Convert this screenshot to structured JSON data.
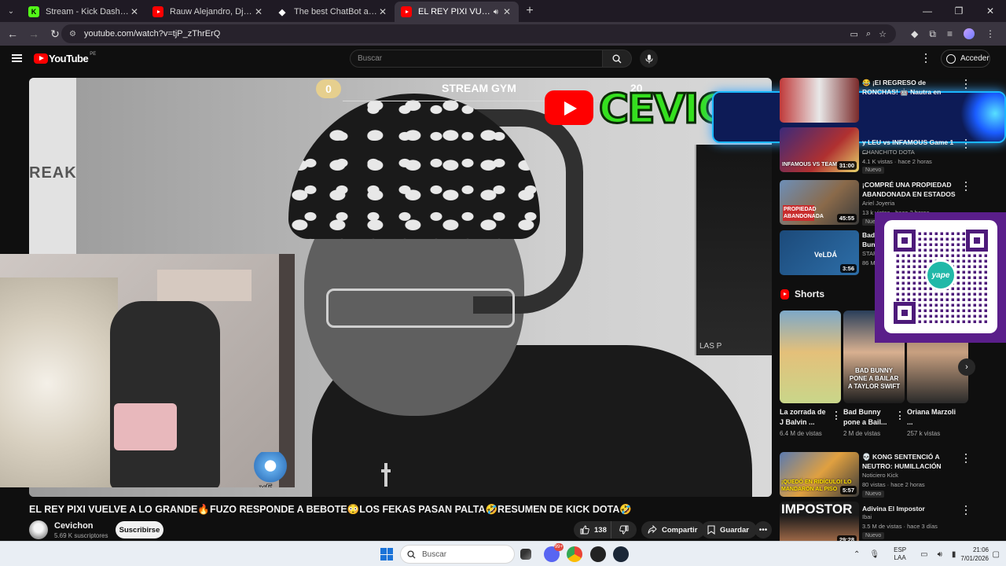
{
  "browser": {
    "tabs": [
      {
        "title": "Stream - Kick Dashboard",
        "favicon": "kick-icon",
        "color": "#53fc18",
        "active": false
      },
      {
        "title": "Rauw Alejandro, Dj Playero - Di",
        "favicon": "youtube-icon",
        "color": "#ff0000",
        "active": false
      },
      {
        "title": "The best ChatBot and Widgets",
        "favicon": "botrix-icon",
        "color": "#ffffff",
        "active": false
      },
      {
        "title": "EL REY PIXI VUELVE A LO G",
        "favicon": "youtube-icon",
        "color": "#ff0000",
        "active": true
      }
    ],
    "url": "youtube.com/watch?v=tjP_zThrErQ"
  },
  "youtube": {
    "logo_text": "YouTube",
    "region": "PE",
    "search_placeholder": "Buscar",
    "signin_label": "Acceder"
  },
  "player": {
    "score_left": "0",
    "score_title": "STREAM GYM",
    "score_right": "20",
    "brand_overlay": "CEVICHON",
    "streak_text": "REAK",
    "cam_badge": "x5",
    "side_text": "LAS P"
  },
  "video": {
    "title": "EL REY PIXI VUELVE A LO GRANDE🔥FUZO RESPONDE A BEBOTE😳LOS FEKAS PASAN PALTA🤣RESUMEN DE KICK DOTA🤣",
    "channel": "Cevichon",
    "subscribers": "5.69 K suscriptores",
    "subscribe_label": "Suscribirse",
    "likes": "138",
    "share_label": "Compartir",
    "save_label": "Guardar"
  },
  "sidebar": {
    "items": [
      {
        "title": "😂 ¡El REGRESO de RONCHAS! 🤖 Nautra en SLAPER BOXES",
        "channel": "",
        "meta": "",
        "duration": "",
        "new": ""
      },
      {
        "title": "y LEU vs INFAMOUS Game 1 ...",
        "channel": "CHANCHITO DOTA",
        "meta": "4.1 K vistas · hace 2 horas",
        "duration": "31:00",
        "new": "Nuevo"
      },
      {
        "title": "¡COMPRÉ UNA PROPIEDAD ABANDONADA EN ESTADOS ...",
        "channel": "Ariel Joyeria",
        "meta": "13 k vistas · hace 2 horas",
        "duration": "45:55",
        "new": "Nuevo"
      },
      {
        "title": "Bad Bunny - VeLDÁ",
        "channel": "STAR",
        "meta": "86 M",
        "duration": "3:56",
        "new": ""
      },
      {
        "title": "💀 KONG SENTENCIÓ A NEUTRO: HUMILLACIÓN FÍSIC...",
        "channel": "Noticiero Kick",
        "meta": "80 vistas · hace 2 horas",
        "duration": "5:57",
        "new": "Nuevo"
      },
      {
        "title": "Adivina El Impostor",
        "channel": "Ibai",
        "meta": "3.5 M de vistas · hace 3 días",
        "duration": "29:28",
        "new": "Nuevo"
      }
    ],
    "thumb_texts": [
      "",
      "INFAMOUS VS TEAM...",
      "PROPIEDAD ABANDONADA",
      "VeLDÁ",
      "¡QUEDÓ EN RIDÍCULO! LO MANDARON AL PISO",
      "IMPOSTOR"
    ]
  },
  "shorts": {
    "heading": "Shorts",
    "items": [
      {
        "title": "La zorrada de J Balvin ...",
        "views": "6.4 M de vistas",
        "caption": ""
      },
      {
        "title": "Bad Bunny pone a Bail...",
        "views": "2 M de vistas",
        "caption": "BAD BUNNY PONE A BAILAR A TAYLOR SWIFT"
      },
      {
        "title": "Oriana Marzoli ...",
        "views": "257 k vistas",
        "caption": ""
      }
    ]
  },
  "overlay": {
    "qr_brand": "yape"
  },
  "taskbar": {
    "search_placeholder": "Buscar",
    "lang_top": "ESP",
    "lang_bottom": "LAA",
    "time": "21:06",
    "date": "7/01/2026",
    "badge": "99+"
  }
}
